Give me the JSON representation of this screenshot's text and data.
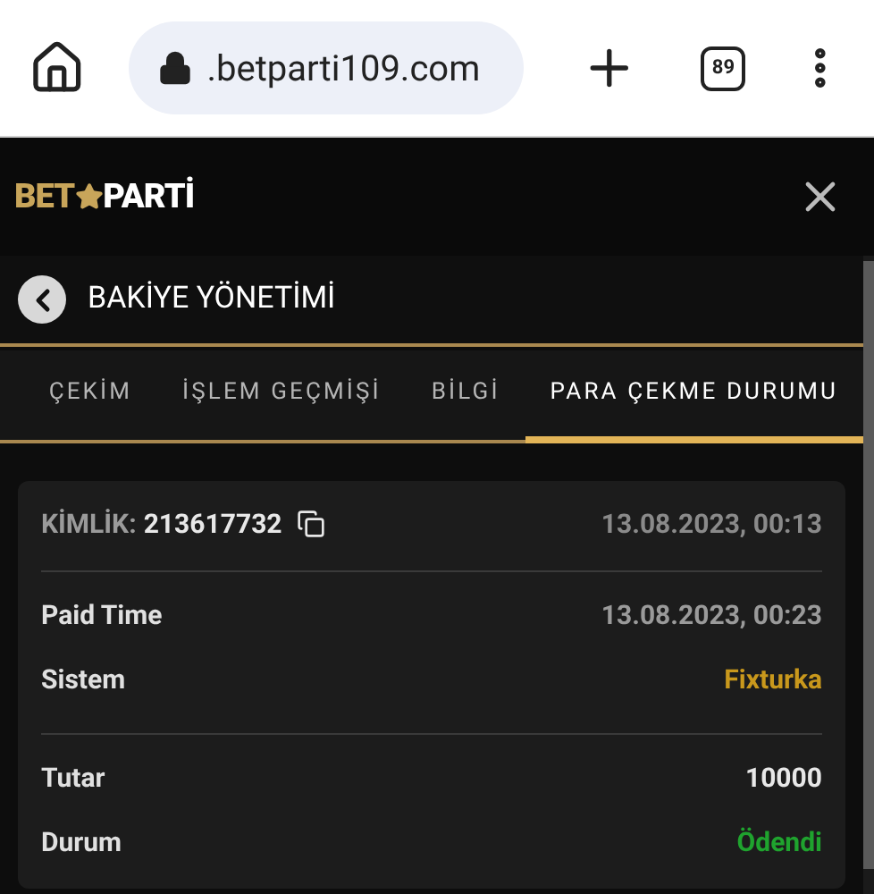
{
  "browser": {
    "url": ".betparti109.com",
    "tab_count": "89"
  },
  "header": {
    "logo": [
      "BET",
      "PARTİ"
    ]
  },
  "title": "BAKİYE YÖNETİMİ",
  "tabs": [
    {
      "label": "ÇEKİM",
      "selected": false
    },
    {
      "label": "İŞLEM GEÇMİŞİ",
      "selected": false
    },
    {
      "label": "BİLGİ",
      "selected": false
    },
    {
      "label": "PARA ÇEKME DURUMU",
      "selected": true
    }
  ],
  "card": {
    "id_label": "KİMLİK:",
    "id": "213617732",
    "time": "13.08.2023, 00:13",
    "sections": [
      [
        {
          "label": "Paid Time",
          "value": "13.08.2023, 00:23",
          "color": "#9a9a9a"
        },
        {
          "label": "Sistem",
          "value": "Fixturka",
          "color": "#c9981c"
        }
      ],
      [
        {
          "label": "Tutar",
          "value": "10000",
          "color": "#e8e8e8"
        },
        {
          "label": "Durum",
          "value": "Ödendi",
          "color": "#1fa32e"
        }
      ]
    ]
  }
}
